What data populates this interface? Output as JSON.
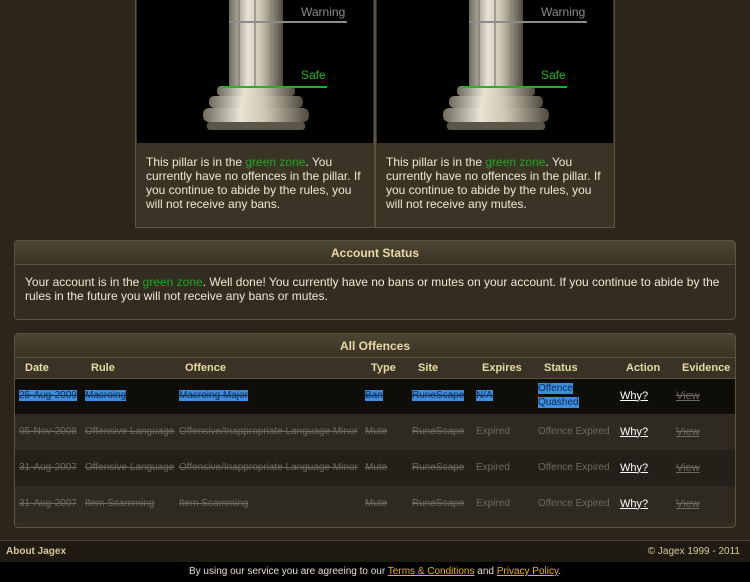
{
  "pillars": [
    {
      "warning_label": "Warning",
      "safe_label": "Safe",
      "text_before": "This pillar is in the ",
      "zone": "green zone",
      "text_after": ". You currently have no offences in the pillar. If you continue to abide by the rules, you will not receive any bans."
    },
    {
      "warning_label": "Warning",
      "safe_label": "Safe",
      "text_before": "This pillar is in the ",
      "zone": "green zone",
      "text_after": ". You currently have no offences in the pillar. If you continue to abide by the rules, you will not receive any mutes."
    }
  ],
  "account_status": {
    "title": "Account Status",
    "text_before": "Your account is in the ",
    "zone": "green zone",
    "text_after": ". Well done! You currently have no bans or mutes on your account. If you continue to abide by the rules in the future you will not receive any bans or mutes."
  },
  "offences": {
    "title": "All Offences",
    "columns": [
      "Date",
      "Rule",
      "Offence",
      "Type",
      "Site",
      "Expires",
      "Status",
      "Action",
      "Evidence"
    ],
    "rows": [
      {
        "date": "25-Aug-2009",
        "rule": "Macroing",
        "offence": "Macroing Major",
        "type": "Ban",
        "site": "RuneScape",
        "expires": "N/A",
        "status": "Offence Quashed",
        "action": "Why?",
        "evidence": "View"
      },
      {
        "date": "05-Nov-2008",
        "rule": "Offensive Language",
        "offence": "Offensive/Inappropriate Language Minor",
        "type": "Mute",
        "site": "RuneScape",
        "expires": "Expired",
        "status": "Offence Expired",
        "action": "Why?",
        "evidence": "View"
      },
      {
        "date": "31-Aug-2007",
        "rule": "Offensive Language",
        "offence": "Offensive/Inappropriate Language Minor",
        "type": "Mute",
        "site": "RuneScape",
        "expires": "Expired",
        "status": "Offence Expired",
        "action": "Why?",
        "evidence": "View"
      },
      {
        "date": "31-Aug-2007",
        "rule": "Item Scamming",
        "offence": "Item Scamming",
        "type": "Mute",
        "site": "RuneScape",
        "expires": "Expired",
        "status": "Offence Expired",
        "action": "Why?",
        "evidence": "View"
      }
    ]
  },
  "footer": {
    "about": "About Jagex",
    "copyright": "© Jagex 1999 - 2011",
    "agree_before": "By using our service you are agreeing to our ",
    "terms": "Terms & Conditions",
    "and": " and ",
    "privacy": "Privacy Policy",
    "end": "."
  },
  "colors": {
    "green_zone": "#1fa71f",
    "highlight": "#3d8ee0",
    "link": "#e8b020"
  }
}
